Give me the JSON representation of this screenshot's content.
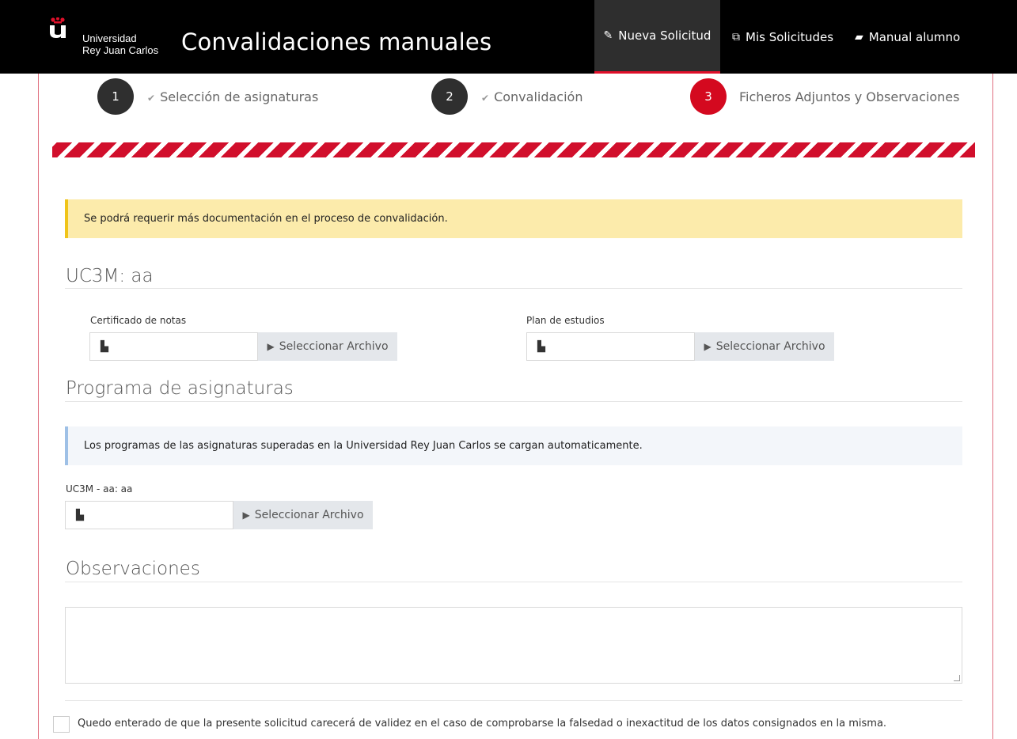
{
  "header": {
    "logo_line1": "Universidad",
    "logo_line2": "Rey Juan Carlos",
    "title": "Convalidaciones manuales",
    "nav": [
      {
        "label": "Nueva Solicitud",
        "icon": "pencil-icon",
        "active": true
      },
      {
        "label": "Mis Solicitudes",
        "icon": "copy-icon",
        "active": false
      },
      {
        "label": "Manual alumno",
        "icon": "book-icon",
        "active": false
      }
    ]
  },
  "steps": [
    {
      "number": "1",
      "label": "Selección de asignaturas",
      "status": "done"
    },
    {
      "number": "2",
      "label": "Convalidación",
      "status": "done"
    },
    {
      "number": "3",
      "label": "Ficheros Adjuntos y Observaciones",
      "status": "current"
    }
  ],
  "warning_alert": "Se podrá requerir más documentación en el proceso de convalidación.",
  "section_uc3m": {
    "title": "UC3M: aa",
    "fields": [
      {
        "label": "Certificado de notas",
        "button": "Seleccionar Archivo"
      },
      {
        "label": "Plan de estudios",
        "button": "Seleccionar Archivo"
      }
    ]
  },
  "section_programa": {
    "title": "Programa de asignaturas",
    "info_alert": "Los programas de las asignaturas superadas en la Universidad Rey Juan Carlos se cargan automaticamente.",
    "field_label": "UC3M - aa: aa",
    "button": "Seleccionar Archivo"
  },
  "section_observaciones": {
    "title": "Observaciones",
    "textarea_value": ""
  },
  "declaration": "Quedo enterado de que la presente solicitud carecerá de validez en el caso de comprobarse la falsedad o inexactitud de los datos consignados en la misma.",
  "colors": {
    "brand_red": "#d4091f",
    "navbar": "#000000",
    "warning_bg": "#fcebab",
    "info_bg": "#f3f6fa"
  }
}
